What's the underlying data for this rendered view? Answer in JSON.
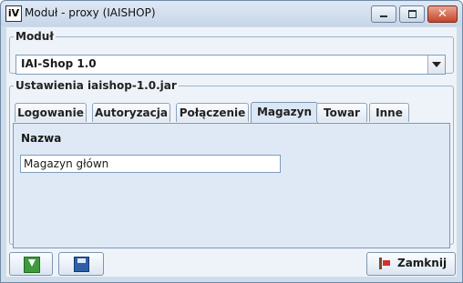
{
  "window": {
    "app_icon_text": "iV",
    "title": "Moduł - proxy (IAISHOP)"
  },
  "module_group": {
    "legend": "Moduł",
    "selected": "IAI-Shop 1.0"
  },
  "settings_group": {
    "legend": "Ustawienia iaishop-1.0.jar",
    "tabs": [
      {
        "label": "Logowanie"
      },
      {
        "label": "Autoryzacja"
      },
      {
        "label": "Połączenie"
      },
      {
        "label": "Magazyn"
      },
      {
        "label": "Towar"
      },
      {
        "label": "Inne"
      }
    ],
    "active_tab": "Magazyn",
    "panel": {
      "name_label": "Nazwa",
      "name_value": "Magazyn główn"
    }
  },
  "footer": {
    "close_label": "Zamknij"
  }
}
